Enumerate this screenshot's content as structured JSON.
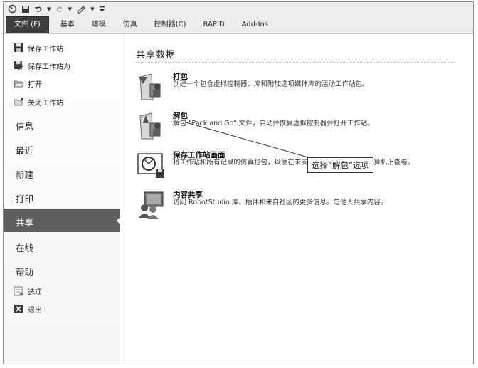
{
  "ribbon": {
    "file_tab": "文件 (F)",
    "tabs": [
      "基本",
      "建模",
      "仿真",
      "控制器(C)",
      "RAPID",
      "Add-Ins"
    ]
  },
  "sidebar": {
    "commands_top": [
      {
        "label": "保存工作站",
        "icon": "save-icon"
      },
      {
        "label": "保存工作站为",
        "icon": "save-as-icon"
      },
      {
        "label": "打开",
        "icon": "open-folder-icon"
      },
      {
        "label": "关闭工作站",
        "icon": "close-station-icon"
      }
    ],
    "categories": [
      "信息",
      "最近",
      "新建",
      "打印",
      "共享",
      "在线",
      "帮助"
    ],
    "active": "共享",
    "commands_bottom": [
      {
        "label": "选项",
        "icon": "options-icon"
      },
      {
        "label": "退出",
        "icon": "exit-icon"
      }
    ]
  },
  "main": {
    "section_title": "共享数据",
    "items": [
      {
        "title": "打包",
        "desc": "创建一个包含虚拟控制器、库和附加选项媒体库的活动工作站包。",
        "icon": "pack-icon"
      },
      {
        "title": "解包",
        "desc": "解包 \"Pack and Go\" 文件，启动并恢复虚拟控制器并打开工作站。",
        "icon": "unpack-icon"
      },
      {
        "title": "保存工作站画面",
        "desc": "将工作站和所有记录的仿真打包，以便在未安装 RobotStudio 的计算机上查看。",
        "icon": "save-station-viewer-icon"
      },
      {
        "title": "内容共享",
        "desc": "访问 RobotStudio 库、插件和来自社区的更多信息。与他人共享内容。",
        "icon": "content-sharing-icon"
      }
    ]
  },
  "annotation": {
    "text": "选择“解包”选项"
  }
}
